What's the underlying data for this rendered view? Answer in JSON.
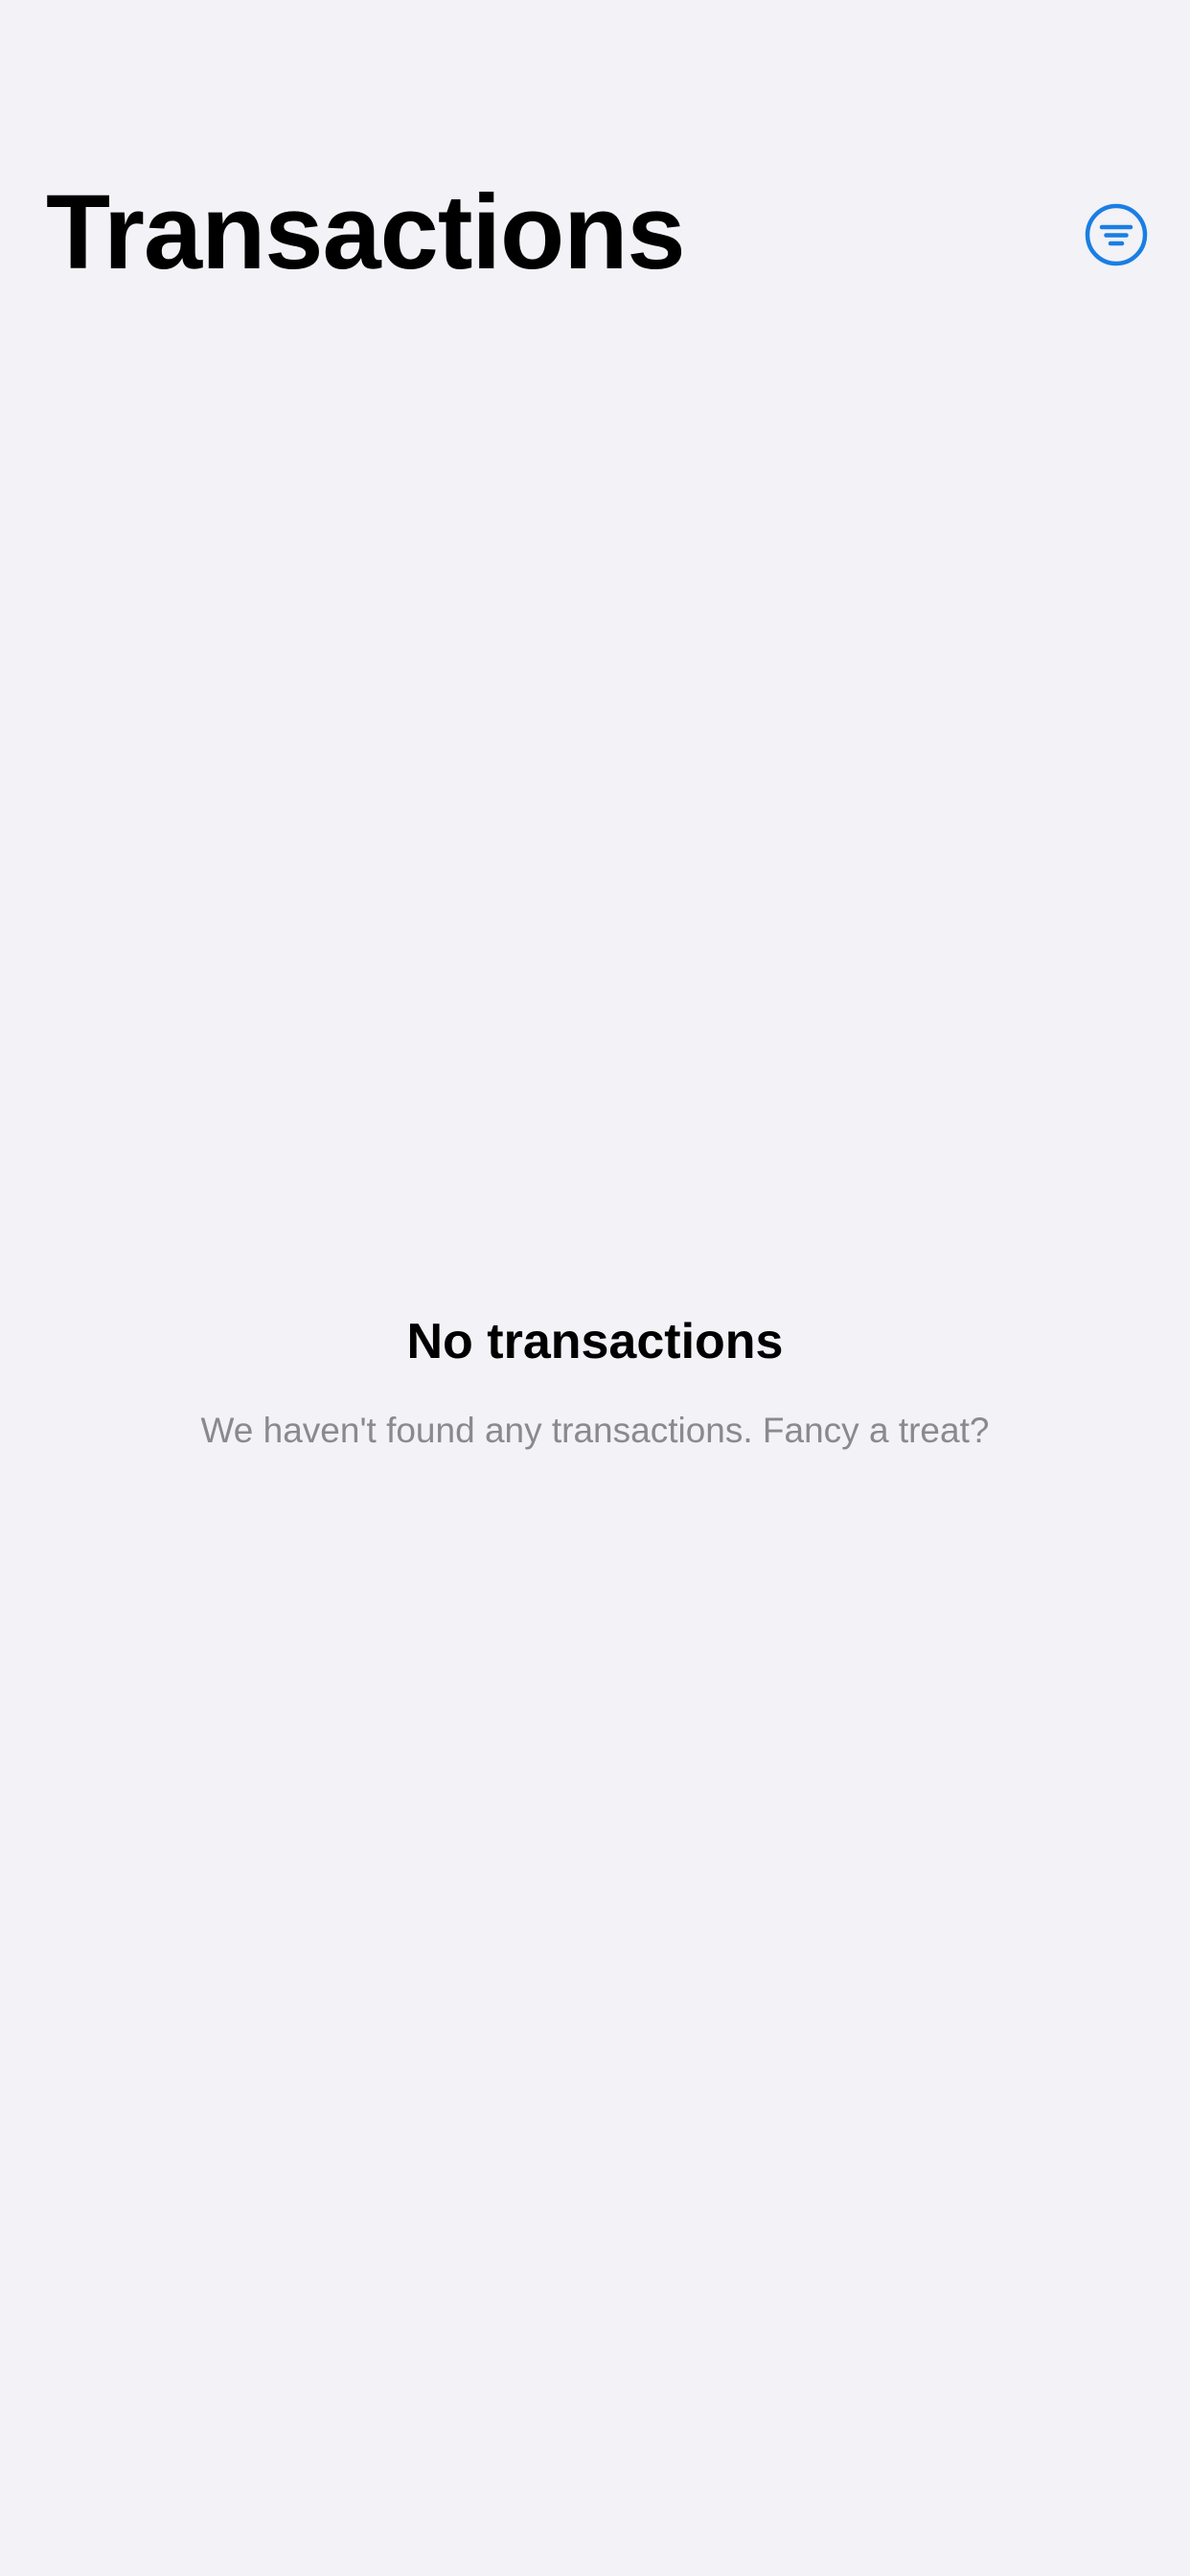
{
  "header": {
    "title": "Transactions",
    "filter_icon": "filter-circle-icon"
  },
  "empty_state": {
    "title": "No transactions",
    "subtitle": "We haven't found any transactions. Fancy a treat?"
  },
  "colors": {
    "background": "#f2f2f7",
    "accent": "#1a7ee3",
    "title": "#000000",
    "secondary_text": "#8a8a8e"
  }
}
